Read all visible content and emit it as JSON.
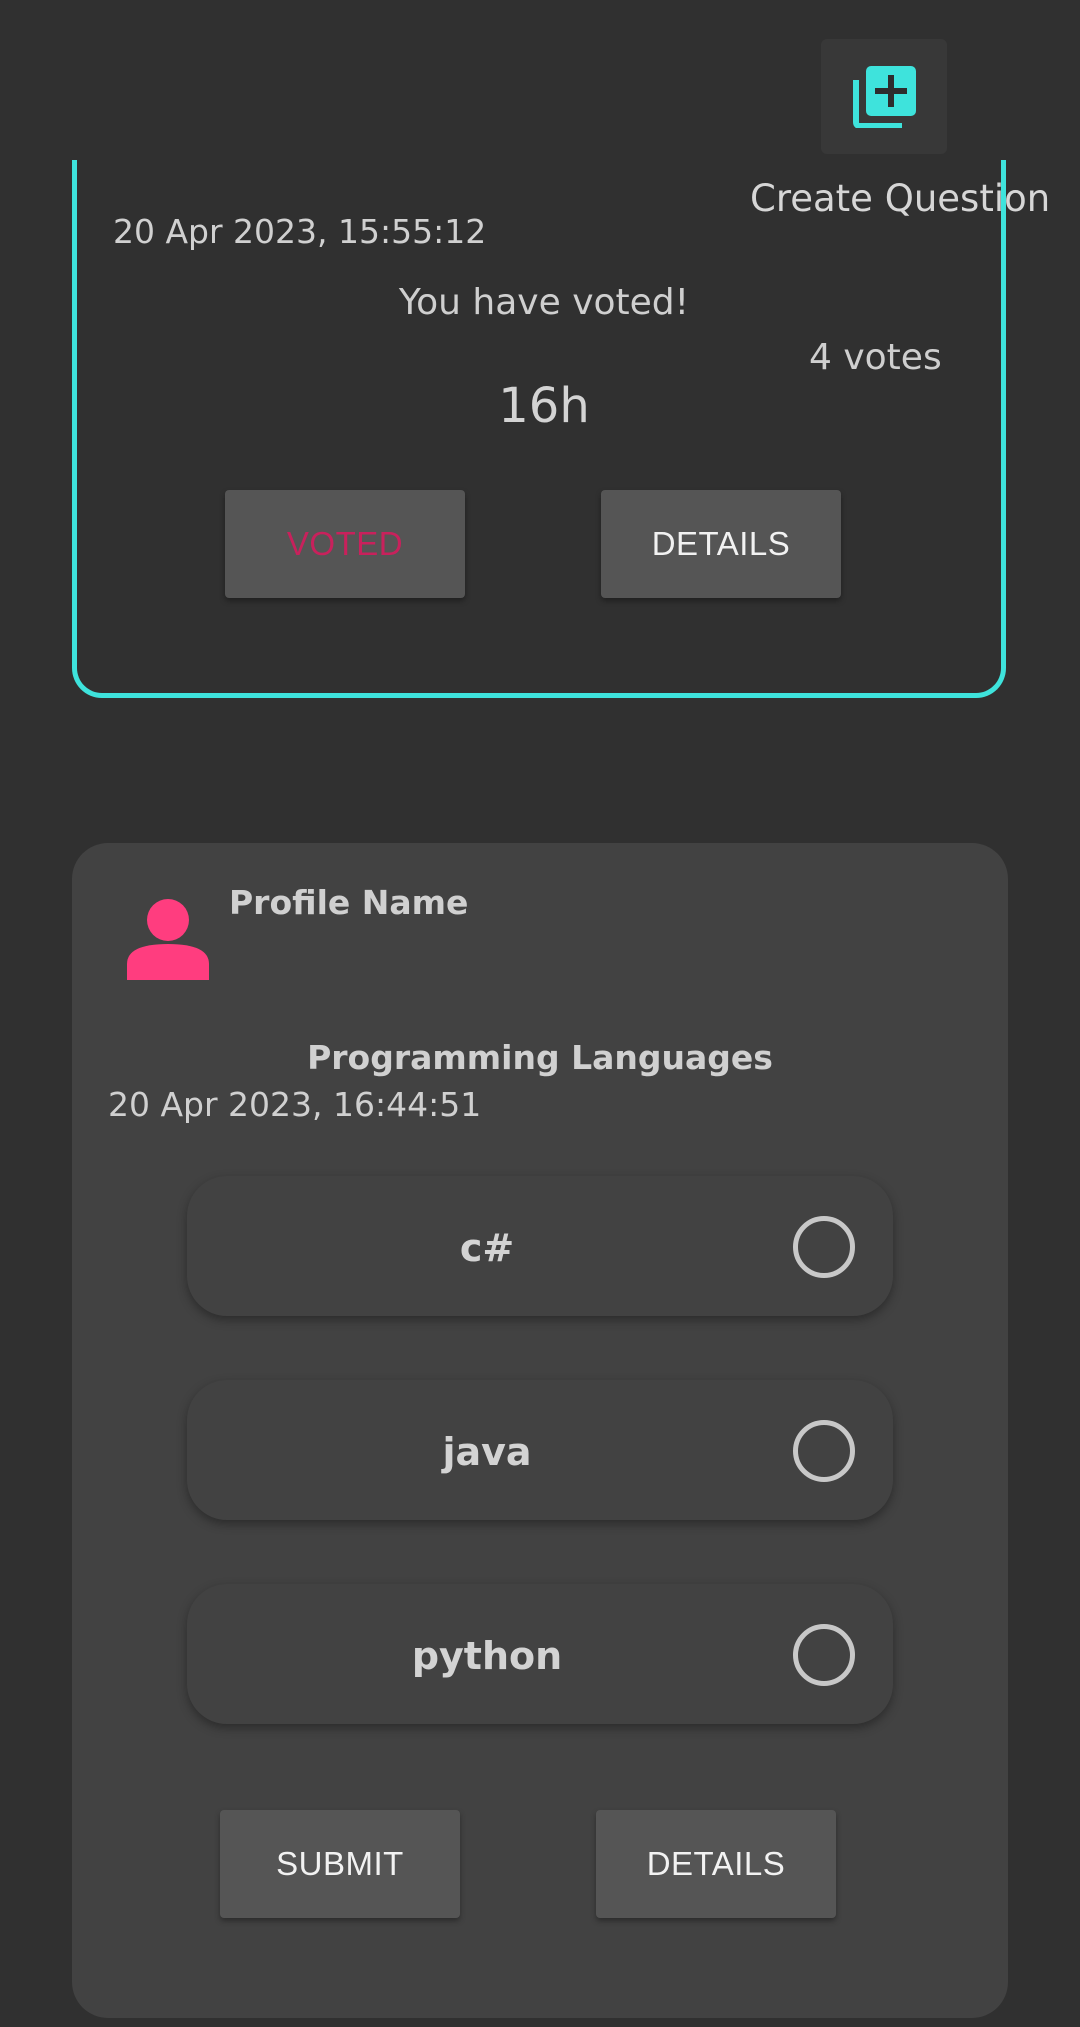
{
  "create_question": {
    "label": "Create Question",
    "icon": "add-to-library-icon",
    "accent_color": "#3ee3dc"
  },
  "voted_card": {
    "timestamp": "20 Apr 2023, 15:55:12",
    "message": "You have voted!",
    "votes": "4 votes",
    "time_left": "16h",
    "voted_button": "VOTED",
    "details_button": "DETAILS",
    "border_color": "#3ee3dc",
    "voted_color": "#c8215c"
  },
  "question_card": {
    "profile_name": "Profile Name",
    "avatar_icon": "person-icon",
    "avatar_color": "#ff3d7f",
    "title": "Programming Languages",
    "timestamp": "20 Apr 2023, 16:44:51",
    "options": [
      {
        "label": "c#",
        "selected": false
      },
      {
        "label": "java",
        "selected": false
      },
      {
        "label": "python",
        "selected": false
      }
    ],
    "submit_button": "SUBMIT",
    "details_button": "DETAILS"
  }
}
